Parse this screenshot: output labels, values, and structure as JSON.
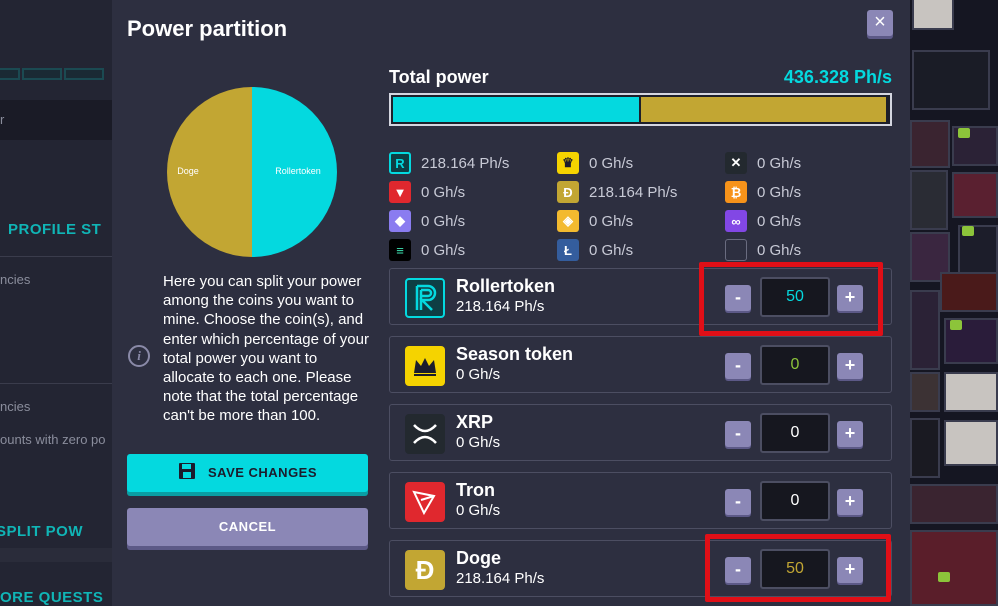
{
  "background": {
    "left_texts": [
      "r",
      "PROFILE ST",
      "ncies",
      "ncies",
      "ounts with zero po",
      "SPLIT POW",
      "ORE QUESTS"
    ]
  },
  "modal": {
    "title": "Power partition",
    "close_label": "×",
    "description": "Here you can split your power among the coins you want to mine. Choose the coin(s), and enter which percentage of your total power you want to allocate to each one. Please note that the total percentage can't be more than 100.",
    "info_label": "i",
    "save_label": "SAVE CHANGES",
    "cancel_label": "CANCEL",
    "pie": {
      "slices": [
        {
          "label": "Rollertoken",
          "percent": 50,
          "color": "#04d9df"
        },
        {
          "label": "Doge",
          "percent": 50,
          "color": "#c2a633"
        }
      ]
    },
    "total_power": {
      "label": "Total power",
      "value": "436.328 Ph/s",
      "segments": [
        {
          "coin": "Rollertoken",
          "percent": 50,
          "color": "#04d9df"
        },
        {
          "coin": "Doge",
          "percent": 50,
          "color": "#c2a633"
        }
      ]
    },
    "coins": [
      {
        "icon": "rollertoken-icon",
        "glyph": "R",
        "value": "218.164 Ph/s"
      },
      {
        "icon": "season-token-icon",
        "glyph": "♛",
        "value": "0 Gh/s"
      },
      {
        "icon": "xrp-icon",
        "glyph": "✕",
        "value": "0 Gh/s"
      },
      {
        "icon": "tron-icon",
        "glyph": "▼",
        "value": "0 Gh/s"
      },
      {
        "icon": "doge-icon",
        "glyph": "Ð",
        "value": "218.164 Ph/s"
      },
      {
        "icon": "bitcoin-icon",
        "glyph": "₿",
        "value": "0 Gh/s"
      },
      {
        "icon": "ethereum-icon",
        "glyph": "◆",
        "value": "0 Gh/s"
      },
      {
        "icon": "bnb-icon",
        "glyph": "◈",
        "value": "0 Gh/s"
      },
      {
        "icon": "matic-icon",
        "glyph": "∞",
        "value": "0 Gh/s"
      },
      {
        "icon": "solana-icon",
        "glyph": "≡",
        "value": "0 Gh/s"
      },
      {
        "icon": "litecoin-icon",
        "glyph": "Ł",
        "value": "0 Gh/s"
      },
      {
        "icon": "blank-coin-icon",
        "glyph": "",
        "value": "0 Gh/s"
      }
    ],
    "rows": [
      {
        "name": "Rollertoken",
        "power": "218.164 Ph/s",
        "percent": "50",
        "minus": "-",
        "plus": "+",
        "percent_color": "#04d9df"
      },
      {
        "name": "Season token",
        "power": "0 Gh/s",
        "percent": "0",
        "minus": "-",
        "plus": "+",
        "percent_color": "#8cc43a"
      },
      {
        "name": "XRP",
        "power": "0 Gh/s",
        "percent": "0",
        "minus": "-",
        "plus": "+",
        "percent_color": "#ffffff"
      },
      {
        "name": "Tron",
        "power": "0 Gh/s",
        "percent": "0",
        "minus": "-",
        "plus": "+",
        "percent_color": "#ffffff"
      },
      {
        "name": "Doge",
        "power": "218.164 Ph/s",
        "percent": "50",
        "minus": "-",
        "plus": "+",
        "percent_color": "#c2a633"
      }
    ]
  }
}
